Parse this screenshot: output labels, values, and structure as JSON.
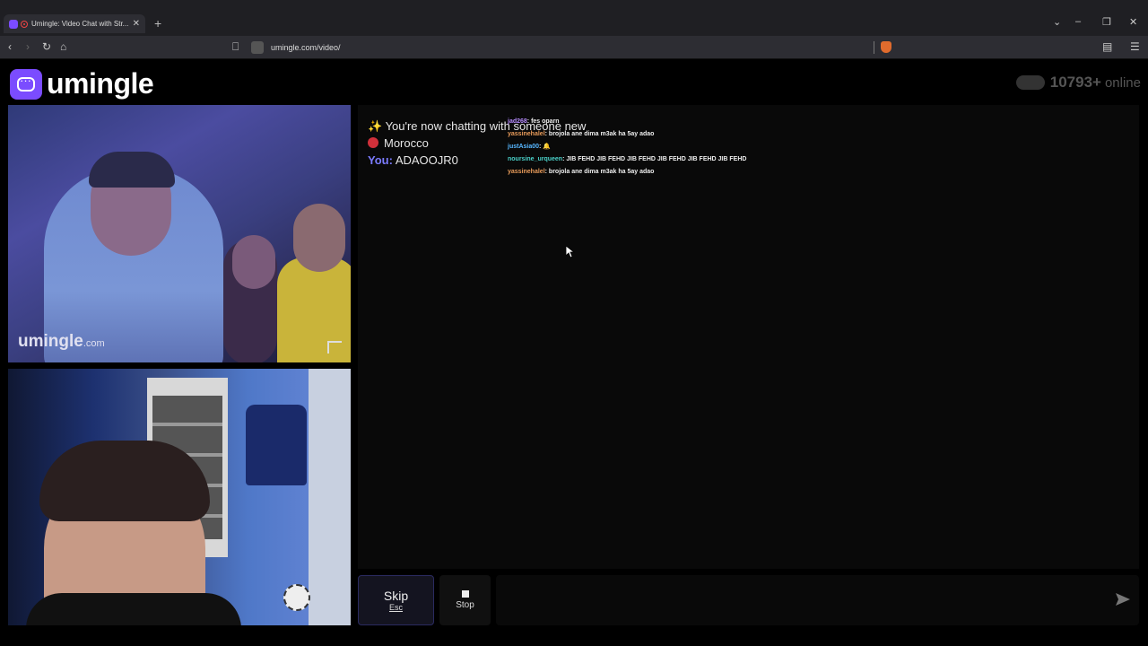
{
  "browser": {
    "tab_title": "Umingle: Video Chat with Str...",
    "url": "umingle.com/video/",
    "new_tab": "+",
    "minimize": "–",
    "restore": "❐",
    "close": "✕"
  },
  "header": {
    "logo_text": "umingle",
    "online_count": "10793+",
    "online_label": "online"
  },
  "video_top": {
    "watermark": "umingle",
    "watermark_suffix": ".com"
  },
  "chat": {
    "status_line": "✨ You're now chatting with someone new",
    "country": "Morocco",
    "you_label": "You:",
    "you_value": "ADAOOJR0",
    "overlay_messages": [
      {
        "user": "jad268",
        "text": ": fes oparn"
      },
      {
        "user": "yassinehalel",
        "text": ": brojola ane dima m3ak ha 5ay adao"
      },
      {
        "user": "justAsia00",
        "text": ": 🔔"
      },
      {
        "user": "noursine_urqueen",
        "text": ": JIB FEHD JIB FEHD JIB FEHD JIB FEHD JIB FEHD JIB FEHD"
      },
      {
        "user": "yassinehalel",
        "text": ": brojola ane dima m3ak ha 5ay adao"
      }
    ]
  },
  "controls": {
    "skip_label": "Skip",
    "skip_key": "Esc",
    "stop_label": "Stop",
    "message_placeholder": ""
  }
}
